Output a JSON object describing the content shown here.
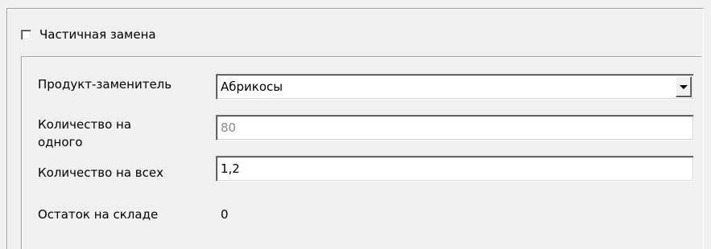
{
  "partial_replacement": {
    "checkbox_label": "Частичная замена",
    "checked": false
  },
  "form": {
    "substitute_product": {
      "label": "Продукт-заменитель",
      "value": "Абрикосы"
    },
    "quantity_per_one": {
      "label_line1": "Количество на",
      "label_line2": "одного",
      "value": "80"
    },
    "quantity_for_all": {
      "label": "Количество на всех",
      "value": "1,2"
    },
    "stock_remaining": {
      "label": "Остаток на складе",
      "value": "0"
    }
  }
}
